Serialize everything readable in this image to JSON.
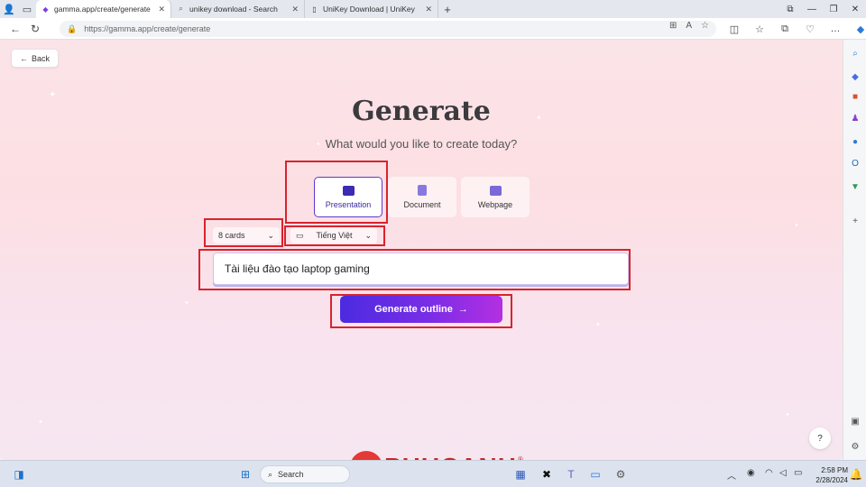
{
  "browser": {
    "tabs": [
      {
        "title": "gamma.app/create/generate",
        "active": true,
        "favicon": "gamma-icon"
      },
      {
        "title": "unikey download - Search",
        "active": false,
        "favicon": "search-icon"
      },
      {
        "title": "UniKey Download | UniKey",
        "active": false,
        "favicon": "page-icon"
      }
    ],
    "url": "https://gamma.app/create/generate"
  },
  "page": {
    "back_label": "Back",
    "headline": "Generate",
    "subtitle": "What would you like to create today?",
    "types": [
      {
        "label": "Presentation",
        "active": true,
        "icon": "presentation-icon",
        "color": "#3b2bb5"
      },
      {
        "label": "Document",
        "active": false,
        "icon": "document-icon",
        "color": "#8a78e0"
      },
      {
        "label": "Webpage",
        "active": false,
        "icon": "webpage-icon",
        "color": "#7a68d8"
      }
    ],
    "card_count": "8 cards",
    "language": "Tiếng Việt",
    "prompt_value": "Tài liệu đào tạo laptop gaming",
    "generate_label": "Generate outline",
    "help_label": "?"
  },
  "watermark": {
    "logo_text": "PHUCANH",
    "logo_mark": "P"
  },
  "taskbar": {
    "search_label": "Search",
    "time": "2:58 PM",
    "date": "2/28/2024"
  },
  "colors": {
    "accent": "#5b3ad1",
    "highlight_box": "#d9232d",
    "button_gradient_start": "#4b2be0",
    "button_gradient_end": "#b42fe2"
  }
}
